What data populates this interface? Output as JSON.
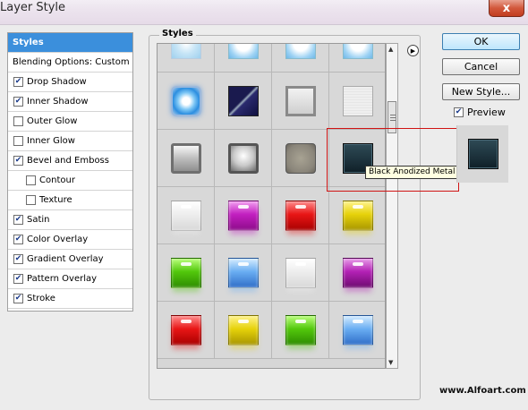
{
  "window": {
    "title": "Layer Style",
    "close_label": "x"
  },
  "left_panel": {
    "items": [
      {
        "label": "Styles",
        "type": "header"
      },
      {
        "label": "Blending Options: Custom",
        "type": "plain"
      },
      {
        "label": "Drop Shadow",
        "checked": true,
        "indent": 0
      },
      {
        "label": "Inner Shadow",
        "checked": true,
        "indent": 0
      },
      {
        "label": "Outer Glow",
        "checked": false,
        "indent": 0
      },
      {
        "label": "Inner Glow",
        "checked": false,
        "indent": 0
      },
      {
        "label": "Bevel and Emboss",
        "checked": true,
        "indent": 0
      },
      {
        "label": "Contour",
        "checked": false,
        "indent": 1
      },
      {
        "label": "Texture",
        "checked": false,
        "indent": 1
      },
      {
        "label": "Satin",
        "checked": true,
        "indent": 0
      },
      {
        "label": "Color Overlay",
        "checked": true,
        "indent": 0
      },
      {
        "label": "Gradient Overlay",
        "checked": true,
        "indent": 0
      },
      {
        "label": "Pattern Overlay",
        "checked": true,
        "indent": 0
      },
      {
        "label": "Stroke",
        "checked": true,
        "indent": 0
      }
    ]
  },
  "styles_panel": {
    "label": "Styles",
    "tooltip": "Black Anodized Metal",
    "swatches": [
      "water",
      "water-glow",
      "water-glow",
      "water-glow",
      "blue-glow",
      "blue-dark-diagonal",
      "silver-frame",
      "silver-plain",
      "chrome",
      "chrome-bright",
      "olive-gray",
      "black-anodized",
      "white",
      "magenta",
      "red",
      "yellow",
      "green",
      "light-blue",
      "white",
      "purple",
      "red",
      "yellow",
      "green",
      "light-blue"
    ]
  },
  "buttons": {
    "ok": "OK",
    "cancel": "Cancel",
    "new_style": "New Style..."
  },
  "preview": {
    "label": "Preview",
    "checked": true
  },
  "watermark": "www.Alfoart.com"
}
